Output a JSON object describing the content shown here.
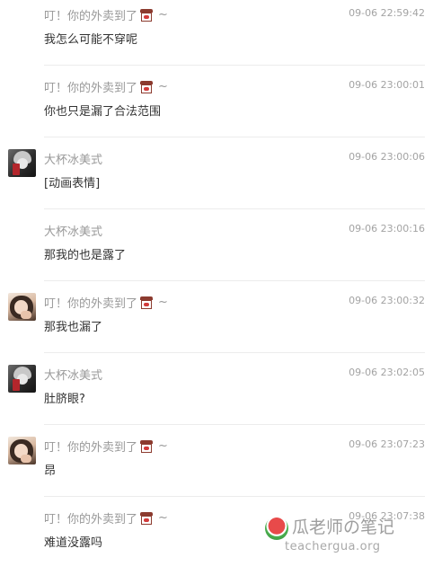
{
  "messages": [
    {
      "user": "叮！你的外卖到了",
      "has_sticker": true,
      "avatar": "none",
      "time": "09-06 22:59:42",
      "text": "我怎么可能不穿呢"
    },
    {
      "user": "叮！你的外卖到了",
      "has_sticker": true,
      "avatar": "none",
      "time": "09-06 23:00:01",
      "text": "你也只是漏了合法范围"
    },
    {
      "user": "大杯冰美式",
      "has_sticker": false,
      "avatar": "dark",
      "time": "09-06 23:00:06",
      "text": "[动画表情]"
    },
    {
      "user": "大杯冰美式",
      "has_sticker": false,
      "avatar": "none",
      "time": "09-06 23:00:16",
      "text": "那我的也是露了"
    },
    {
      "user": "叮！你的外卖到了",
      "has_sticker": true,
      "avatar": "light",
      "time": "09-06 23:00:32",
      "text": "那我也漏了"
    },
    {
      "user": "大杯冰美式",
      "has_sticker": false,
      "avatar": "dark",
      "time": "09-06 23:02:05",
      "text": "肚脐眼?"
    },
    {
      "user": "叮！你的外卖到了",
      "has_sticker": true,
      "avatar": "light",
      "time": "09-06 23:07:23",
      "text": "昂"
    },
    {
      "user": "叮！你的外卖到了",
      "has_sticker": true,
      "avatar": "none",
      "time": "09-06 23:07:38",
      "text": "难道没露吗"
    }
  ],
  "tilde": "~",
  "watermark": {
    "title": "瓜老师の笔记",
    "url": "teachergua.org"
  }
}
